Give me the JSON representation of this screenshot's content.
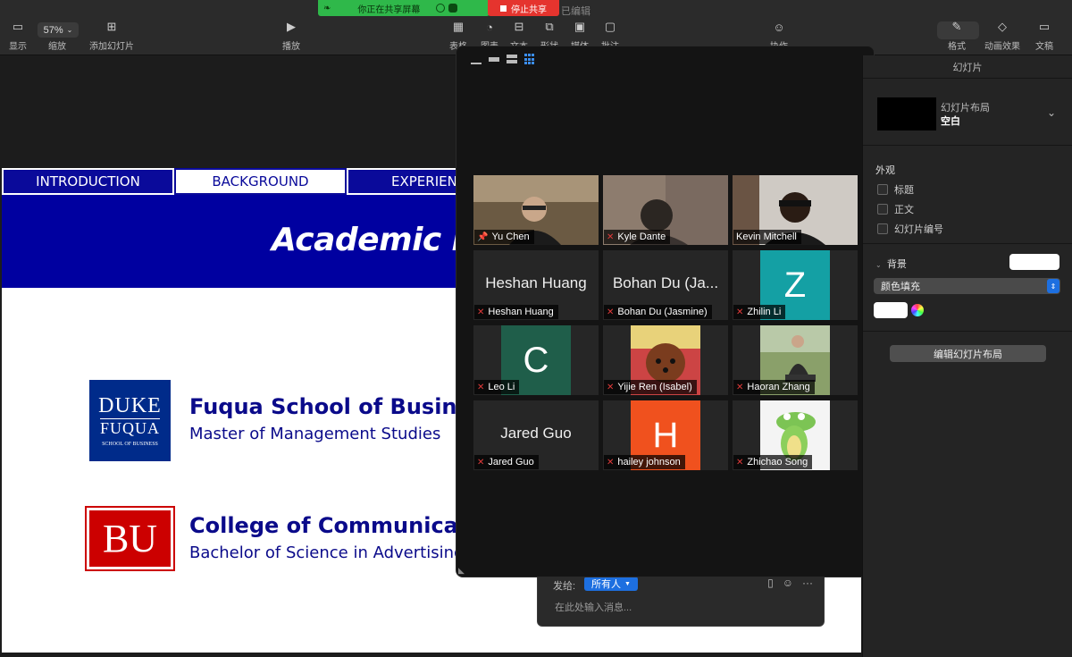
{
  "toolbar": {
    "zoom_value": "57%",
    "items": {
      "view": "显示",
      "zoom": "缩放",
      "add_slide": "添加幻灯片",
      "play": "播放",
      "table": "表格",
      "chart": "图表",
      "text": "文本",
      "shape": "形状",
      "media": "媒体",
      "comment": "批注",
      "collaborate": "协作",
      "format": "格式",
      "animate": "动画效果",
      "document": "文稿"
    },
    "status": "已编辑"
  },
  "share": {
    "banner_text": "你正在共享屏幕",
    "stop_label": "停止共享"
  },
  "slide": {
    "nav_tabs": [
      "INTRODUCTION",
      "BACKGROUND",
      "EXPERIENC"
    ],
    "active_tab": "BACKGROUND",
    "title": "Academic Ba",
    "duke_logo": {
      "line1": "DUKE",
      "line2": "FUQUA",
      "line3": "SCHOOL OF BUSINESS"
    },
    "bu_logo": "BU",
    "entries": [
      {
        "school": "Fuqua School of Business,",
        "degree": "Master of Management Studies"
      },
      {
        "school": "College of Communication",
        "degree": "Bachelor of Science in Advertising and"
      }
    ]
  },
  "chat": {
    "to_label": "发给:",
    "to_value": "所有人",
    "placeholder": "在此处输入消息..."
  },
  "gallery": {
    "participants": [
      {
        "name": "Yu Chen",
        "type": "video",
        "pinned": true,
        "active": true
      },
      {
        "name": "Kyle Dante",
        "type": "video",
        "muted": true
      },
      {
        "name": "Kevin Mitchell",
        "type": "video"
      },
      {
        "name": "Heshan Huang",
        "type": "name",
        "muted": true
      },
      {
        "name": "Bohan Du (Jasmine)",
        "display": "Bohan Du (Ja...",
        "type": "name",
        "muted": true
      },
      {
        "name": "Zhilin Li",
        "type": "avatar",
        "letter": "Z",
        "color": "#14a0a4",
        "muted": true
      },
      {
        "name": "Leo Li",
        "type": "avatar",
        "letter": "C",
        "color": "#1f5e4a",
        "muted": true
      },
      {
        "name": "Yijie Ren (Isabel)",
        "type": "photo",
        "muted": true
      },
      {
        "name": "Haoran Zhang",
        "type": "photo",
        "muted": true
      },
      {
        "name": "Jared Guo",
        "type": "name",
        "muted": true
      },
      {
        "name": "hailey johnson",
        "type": "avatar",
        "letter": "H",
        "color": "#f0511e",
        "muted": true
      },
      {
        "name": "Zhichao Song",
        "type": "photo",
        "muted": true
      }
    ]
  },
  "panel": {
    "title": "幻灯片",
    "layout_label": "幻灯片布局",
    "layout_value": "空白",
    "appearance": "外观",
    "checkboxes": [
      "标题",
      "正文",
      "幻灯片编号"
    ],
    "background": "背景",
    "fill": "颜色填充",
    "edit_layout": "编辑幻灯片布局"
  }
}
